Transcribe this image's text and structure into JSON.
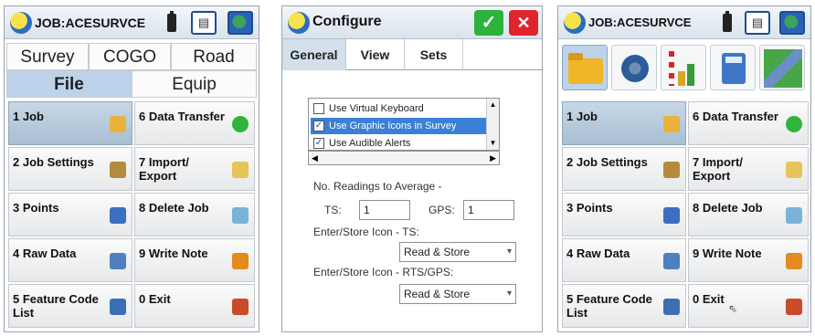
{
  "panel1": {
    "title": "JOB:ACESURVCE",
    "tabs": [
      "Survey",
      "COGO",
      "Road",
      "File",
      "Equip"
    ],
    "active_tab": "File",
    "buttons": [
      {
        "label": "1 Job",
        "icon": "folder-open-icon",
        "color": "#e9b23a"
      },
      {
        "label": "6 Data Transfer",
        "icon": "data-transfer-icon",
        "color": "#2fb53c"
      },
      {
        "label": "2 Job Settings",
        "icon": "job-settings-icon",
        "color": "#b48a3b"
      },
      {
        "label": "7 Import/ Export",
        "icon": "import-export-icon",
        "color": "#e7c45a"
      },
      {
        "label": "3 Points",
        "icon": "points-list-icon",
        "color": "#3a6fc2"
      },
      {
        "label": "8 Delete Job",
        "icon": "delete-job-icon",
        "color": "#7ab3d8"
      },
      {
        "label": "4 Raw Data",
        "icon": "raw-data-icon",
        "color": "#4f7fbf"
      },
      {
        "label": "9 Write Note",
        "icon": "pencil-icon",
        "color": "#e58a1f"
      },
      {
        "label": "5 Feature Code List",
        "icon": "feature-code-book-icon",
        "color": "#3b6fb5"
      },
      {
        "label": "0 Exit",
        "icon": "exit-door-icon",
        "color": "#c94b2a"
      }
    ],
    "selected": "1 Job"
  },
  "panel2": {
    "title": "Configure",
    "tabs": [
      "General",
      "View",
      "Sets"
    ],
    "active_tab": "General",
    "list_items": [
      {
        "label": "Use Virtual Keyboard",
        "checked": false
      },
      {
        "label": "Use Graphic Icons in Survey",
        "checked": true
      },
      {
        "label": "Use Audible Alerts",
        "checked": true
      }
    ],
    "readings_label": "No. Readings to Average -",
    "ts_label": "TS:",
    "ts_value": "1",
    "gps_label": "GPS:",
    "gps_value": "1",
    "enter_store_ts_label": "Enter/Store Icon - TS:",
    "enter_store_ts_value": "Read & Store",
    "enter_store_rts_label": "Enter/Store Icon - RTS/GPS:",
    "enter_store_rts_value": "Read & Store"
  },
  "panel3": {
    "title": "JOB:ACESURVCE",
    "buttons": [
      {
        "label": "1 Job",
        "icon": "folder-open-icon",
        "color": "#e9b23a"
      },
      {
        "label": "6 Data Transfer",
        "icon": "data-transfer-icon",
        "color": "#2fb53c"
      },
      {
        "label": "2 Job Settings",
        "icon": "job-settings-icon",
        "color": "#b48a3b"
      },
      {
        "label": "7 Import/ Export",
        "icon": "import-export-icon",
        "color": "#e7c45a"
      },
      {
        "label": "3 Points",
        "icon": "points-list-icon",
        "color": "#3a6fc2"
      },
      {
        "label": "8 Delete Job",
        "icon": "delete-job-icon",
        "color": "#7ab3d8"
      },
      {
        "label": "4 Raw Data",
        "icon": "raw-data-icon",
        "color": "#4f7fbf"
      },
      {
        "label": "9 Write Note",
        "icon": "pencil-icon",
        "color": "#e58a1f"
      },
      {
        "label": "5 Feature Code List",
        "icon": "feature-code-book-icon",
        "color": "#3b6fb5"
      },
      {
        "label": "0 Exit",
        "icon": "exit-door-icon",
        "color": "#c94b2a"
      }
    ],
    "selected": "1 Job"
  }
}
